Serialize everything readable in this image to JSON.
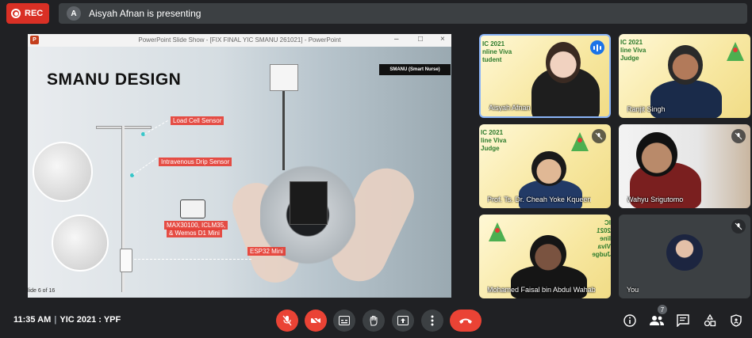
{
  "recording": {
    "label": "REC"
  },
  "presenting": {
    "avatar_letter": "A",
    "text": "Aisyah Afnan is presenting"
  },
  "slide_window": {
    "title": "PowerPoint Slide Show - [FIX FINAL YIC SMANU 261021] - PowerPoint",
    "slide_title": "SMANU DESIGN",
    "badge": "SMANU (Smart Nurse)",
    "labels": {
      "load_cell": "Load Cell Sensor",
      "drip": "Intravenous Drip Sensor",
      "max": "MAX30100, ICLM35,",
      "wemos": "& Wemos D1 Mini",
      "esp": "ESP32 Mini"
    },
    "slide_number": "lide 6 of 16"
  },
  "participants": [
    {
      "name": "Aisyah Afnan",
      "banner": "IC 2021\nnline Viva\ntudent",
      "status": "speaking"
    },
    {
      "name": "Ranjit Singh",
      "banner": "IC 2021\nline Viva\nJudge",
      "status": "muted"
    },
    {
      "name": "Prof. Ts. Dr. Cheah Yoke Kqueen",
      "banner": "IC 2021\nline Viva\nJudge",
      "status": "muted"
    },
    {
      "name": "Wahyu Srigutomo",
      "banner": "",
      "status": "muted"
    },
    {
      "name": "Mohamed Faisal bin Abdul Wahab",
      "banner": "IC 2021\nline Viva\nJudge",
      "status": "none"
    },
    {
      "name": "You",
      "banner": "",
      "status": "muted"
    }
  ],
  "bottom_bar": {
    "time": "11:35 AM",
    "meeting": "YIC 2021 : YPF",
    "participant_count": "7"
  },
  "colors": {
    "end_call": "#ea4335",
    "accent": "#1a73e8",
    "bar": "#3c4043"
  }
}
